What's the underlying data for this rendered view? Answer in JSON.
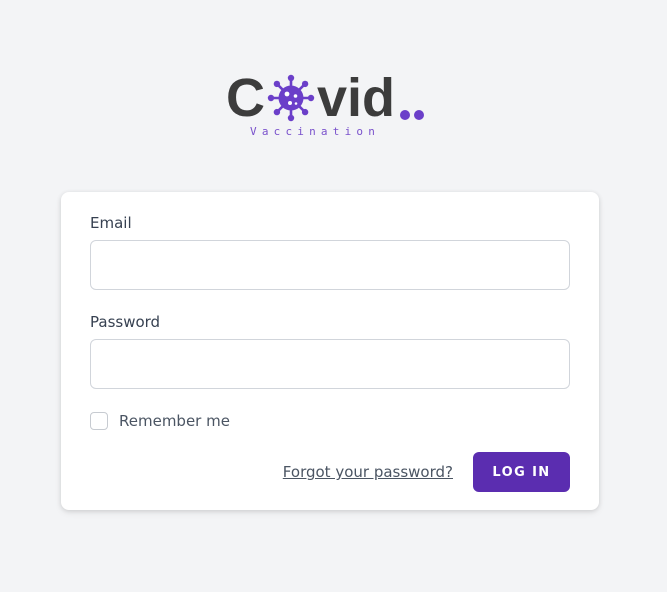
{
  "logo": {
    "word_start": "C",
    "word_end": "vid",
    "subtitle": "Vaccination",
    "icon": "virus-icon",
    "accent_color": "#6b3fc9"
  },
  "form": {
    "email_label": "Email",
    "email_value": "",
    "password_label": "Password",
    "password_value": "",
    "remember_label": "Remember me",
    "remember_checked": false,
    "forgot_link": "Forgot your password?",
    "login_button": "LOG IN",
    "button_color": "#5b2db0"
  }
}
